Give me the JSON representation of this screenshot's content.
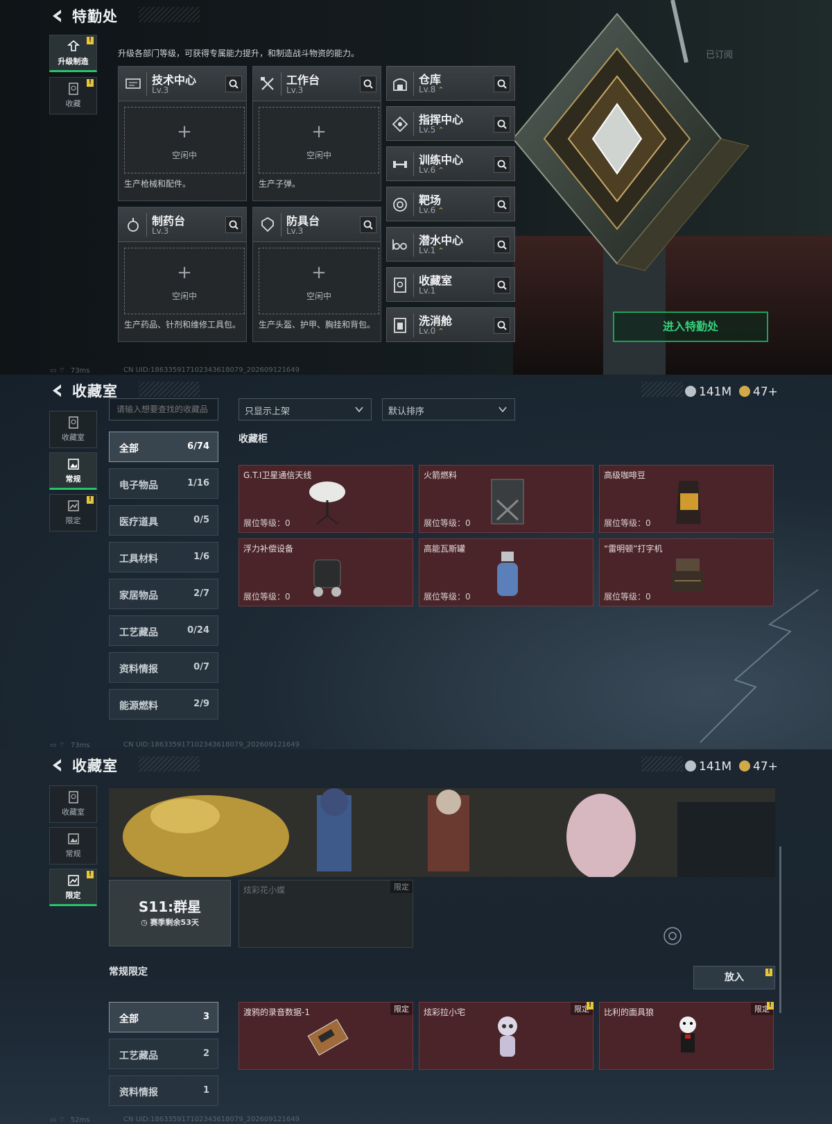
{
  "screen1": {
    "title": "特勤处",
    "sidetabs": [
      {
        "label": "升级制造",
        "icon": "upgrade-icon",
        "active": true,
        "warn": "!"
      },
      {
        "label": "收藏",
        "icon": "collection-icon",
        "active": false,
        "warn": "!"
      }
    ],
    "intro": "升级各部门等级，可获得专属能力提升，和制造战斗物资的能力。",
    "subscribed": "已订阅",
    "workshops": [
      {
        "name": "技术中心",
        "level": "Lv.3",
        "slot": "空闲中",
        "desc": "生产枪械和配件。",
        "icon": "tech-center-icon"
      },
      {
        "name": "工作台",
        "level": "Lv.3",
        "slot": "空闲中",
        "desc": "生产子弹。",
        "icon": "workbench-icon"
      },
      {
        "name": "制药台",
        "level": "Lv.3",
        "slot": "空闲中",
        "desc": "生产药品、针剂和维修工具包。",
        "icon": "pharmacy-icon"
      },
      {
        "name": "防具台",
        "level": "Lv.3",
        "slot": "空闲中",
        "desc": "生产头盔、护甲、胸挂和背包。",
        "icon": "armor-bench-icon"
      }
    ],
    "facilities": [
      {
        "name": "仓库",
        "level": "Lv.8",
        "upgradable": true,
        "icon": "warehouse-icon"
      },
      {
        "name": "指挥中心",
        "level": "Lv.5",
        "upgradable": true,
        "icon": "command-center-icon"
      },
      {
        "name": "训练中心",
        "level": "Lv.6",
        "upgradable": true,
        "icon": "training-center-icon"
      },
      {
        "name": "靶场",
        "level": "Lv.6",
        "upgradable": true,
        "icon": "shooting-range-icon"
      },
      {
        "name": "潜水中心",
        "level": "Lv.1",
        "upgradable": true,
        "icon": "diving-center-icon"
      },
      {
        "name": "收藏室",
        "level": "Lv.1",
        "upgradable": false,
        "icon": "collection-room-icon"
      },
      {
        "name": "洗消舱",
        "level": "Lv.0",
        "upgradable": true,
        "icon": "decon-chamber-icon"
      }
    ],
    "enter_button": "进入特勤处",
    "status": {
      "ping": "73ms",
      "uid": "CN UID:18633591710234361807​9_202609121649"
    }
  },
  "screen2": {
    "title": "收藏室",
    "currency": [
      {
        "value": "141M",
        "color": "#b9c2c8"
      },
      {
        "value": "47+",
        "color": "#d2a94a"
      }
    ],
    "sidetabs": [
      {
        "label": "收藏室",
        "icon": "collection-room-icon",
        "active": false
      },
      {
        "label": "常规",
        "icon": "regular-icon",
        "active": true
      },
      {
        "label": "限定",
        "icon": "limited-icon",
        "active": false,
        "warn": "!"
      }
    ],
    "search_placeholder": "请输入想要查找的收藏品",
    "filter_dropdown": "只显示上架",
    "sort_dropdown": "默认排序",
    "categories": [
      {
        "name": "全部",
        "count": "6/74",
        "active": true
      },
      {
        "name": "电子物品",
        "count": "1/16"
      },
      {
        "name": "医疗道具",
        "count": "0/5"
      },
      {
        "name": "工具材料",
        "count": "1/6"
      },
      {
        "name": "家居物品",
        "count": "2/7"
      },
      {
        "name": "工艺藏品",
        "count": "0/24"
      },
      {
        "name": "资料情报",
        "count": "0/7"
      },
      {
        "name": "能源燃料",
        "count": "2/9"
      }
    ],
    "section_title": "收藏柜",
    "display_level_label": "展位等级：",
    "items": [
      {
        "name": "G.T.I卫星通信天线",
        "level": "0",
        "icon": "satellite-antenna-icon"
      },
      {
        "name": "火箭燃料",
        "level": "0",
        "icon": "fuel-can-icon"
      },
      {
        "name": "高级咖啡豆",
        "level": "0",
        "icon": "coffee-bag-icon"
      },
      {
        "name": "浮力补偿设备",
        "level": "0",
        "icon": "bcd-icon"
      },
      {
        "name": "高能瓦斯罐",
        "level": "0",
        "icon": "gas-canister-icon"
      },
      {
        "name": "“雷明顿”打字机",
        "level": "0",
        "icon": "typewriter-icon"
      }
    ],
    "status": {
      "ping": "73ms",
      "uid": "CN UID:18633591710234361807​9_202609121649"
    }
  },
  "screen3": {
    "title": "收藏室",
    "currency": [
      {
        "value": "141M",
        "color": "#b9c2c8"
      },
      {
        "value": "47+",
        "color": "#d2a94a"
      }
    ],
    "sidetabs": [
      {
        "label": "收藏室",
        "icon": "collection-room-icon",
        "active": false
      },
      {
        "label": "常规",
        "icon": "regular-icon",
        "active": false
      },
      {
        "label": "限定",
        "icon": "limited-icon",
        "active": true,
        "warn": "!"
      }
    ],
    "season": {
      "name": "S11:群星",
      "remaining": "赛季剩余53天"
    },
    "featured": {
      "name": "炫彩花小蝶",
      "tag": "限定"
    },
    "section_title": "常规限定",
    "place_button": "放入",
    "categories": [
      {
        "name": "全部",
        "count": "3",
        "active": true
      },
      {
        "name": "工艺藏品",
        "count": "2"
      },
      {
        "name": "资料情报",
        "count": "1"
      }
    ],
    "items": [
      {
        "name": "渡鸦的录音数据-1",
        "tag": "限定",
        "icon": "cassette-icon"
      },
      {
        "name": "炫彩拉小宅",
        "tag": "限定",
        "warn": "!",
        "icon": "doll-icon"
      },
      {
        "name": "比利的面具狼",
        "tag": "限定",
        "warn": "!",
        "icon": "puppet-icon"
      }
    ],
    "status": {
      "ping": "52ms",
      "uid": "CN UID:18633591710234361807​9_202609121649"
    }
  }
}
